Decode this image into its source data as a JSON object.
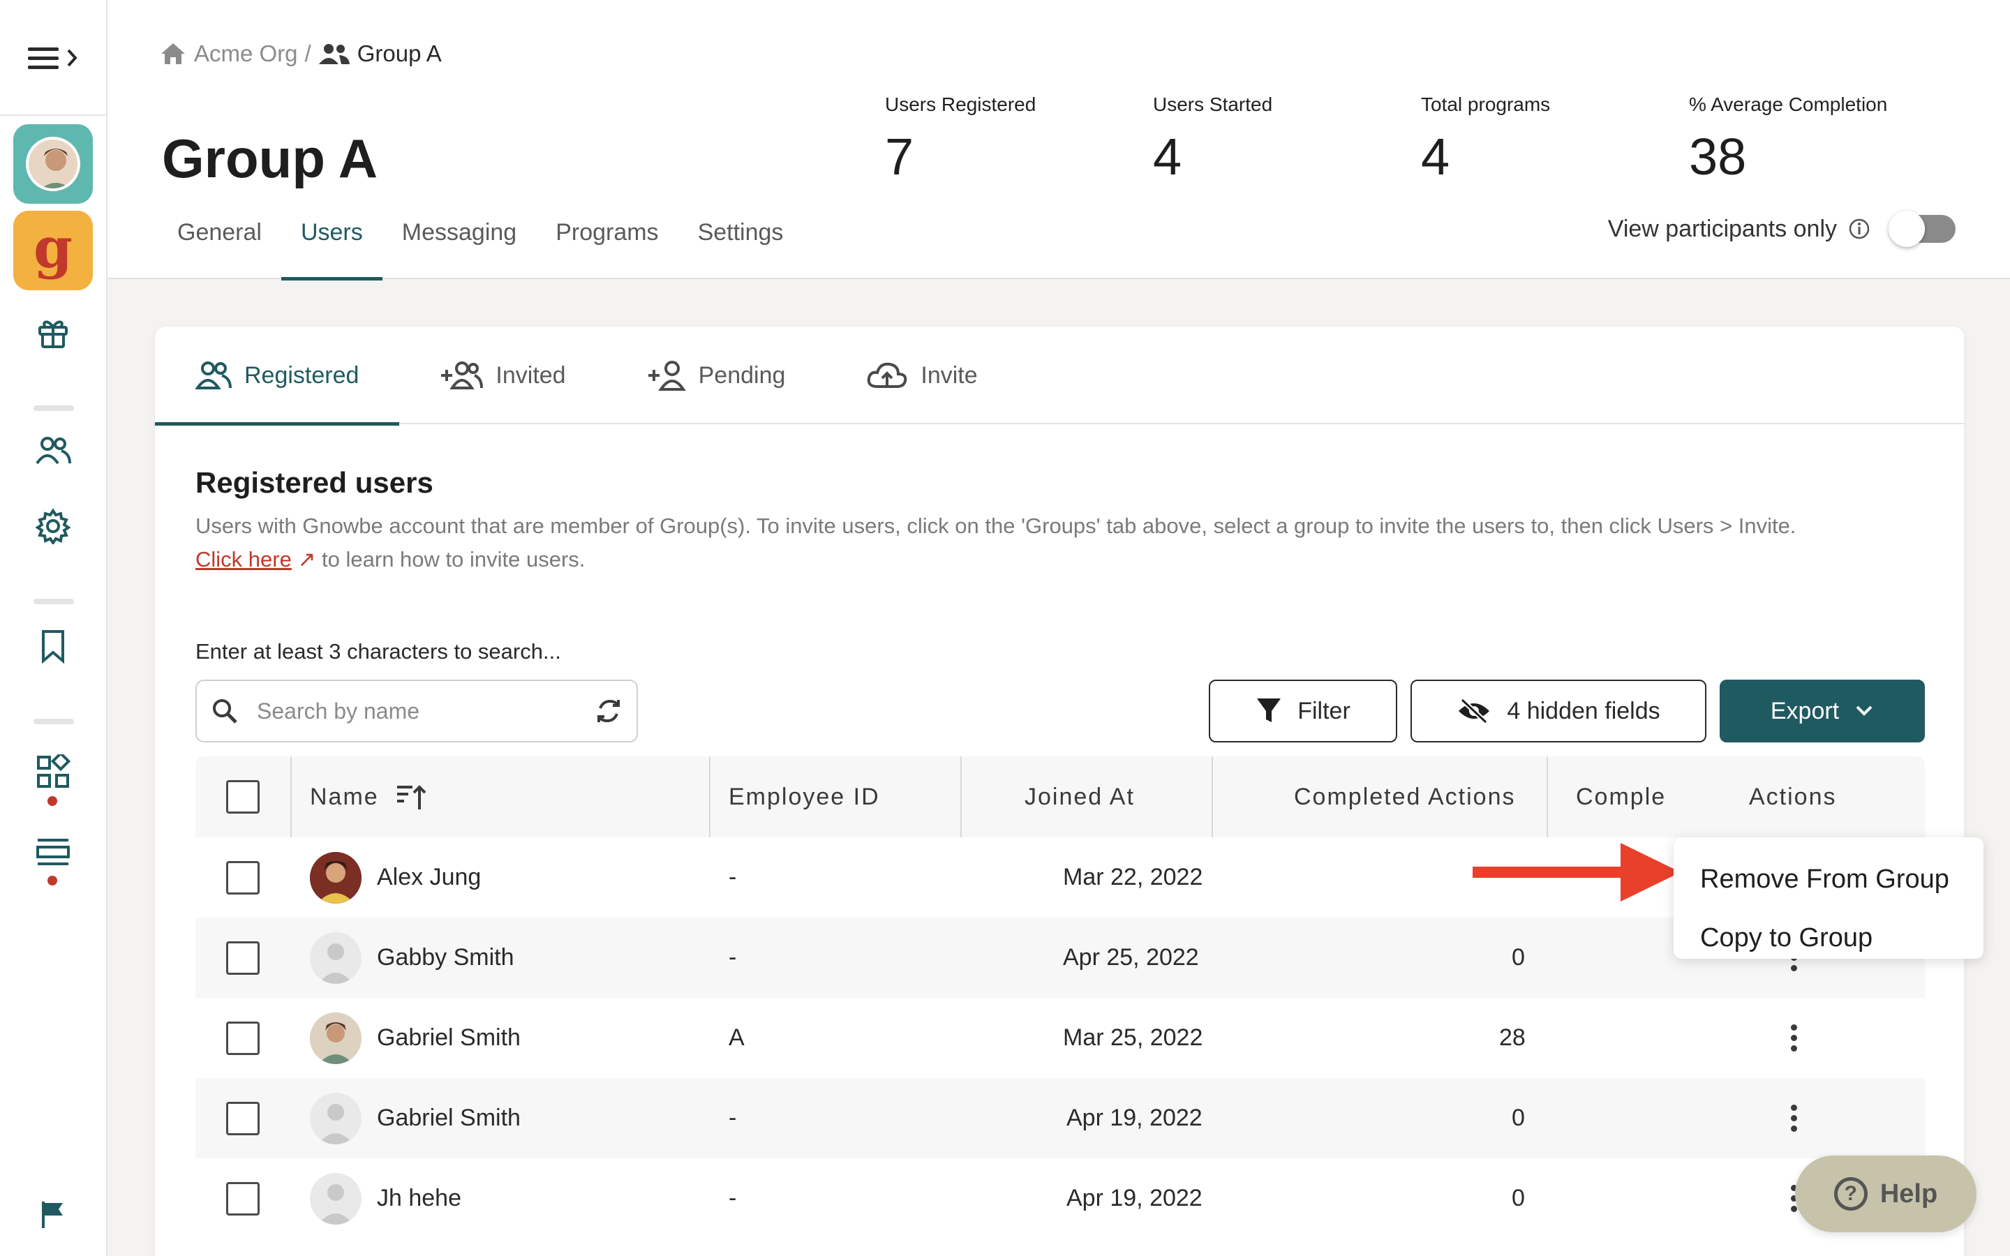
{
  "breadcrumb": {
    "org": "Acme Org",
    "separator": "/",
    "group": "Group A"
  },
  "page": {
    "title": "Group A"
  },
  "stats": [
    {
      "label": "Users Registered",
      "value": "7"
    },
    {
      "label": "Users Started",
      "value": "4"
    },
    {
      "label": "Total programs",
      "value": "4"
    },
    {
      "label": "% Average Completion",
      "value": "38"
    }
  ],
  "tabs": [
    "General",
    "Users",
    "Messaging",
    "Programs",
    "Settings"
  ],
  "active_tab": "Users",
  "participants_toggle": {
    "label": "View participants only",
    "on": false
  },
  "subtabs": [
    "Registered",
    "Invited",
    "Pending",
    "Invite"
  ],
  "section": {
    "title": "Registered users",
    "description": "Users with Gnowbe account that are member of Group(s). To invite users, click on the 'Groups' tab above, select a group to invite the users to, then click Users > Invite.",
    "link_text": "Click here",
    "link_suffix": " to learn how to invite users."
  },
  "search": {
    "hint": "Enter at least 3 characters to search...",
    "placeholder": "Search by name"
  },
  "toolbar": {
    "filter_label": "Filter",
    "hidden_fields_label": "4 hidden fields",
    "export_label": "Export"
  },
  "table": {
    "columns": [
      "Name",
      "Employee ID",
      "Joined At",
      "Completed Actions",
      "Comple",
      "Actions"
    ],
    "rows": [
      {
        "name": "Alex Jung",
        "employee_id": "-",
        "joined_at": "Mar 22, 2022",
        "completed_actions": ""
      },
      {
        "name": "Gabby Smith",
        "employee_id": "-",
        "joined_at": "Apr 25, 2022",
        "completed_actions": "0"
      },
      {
        "name": "Gabriel Smith",
        "employee_id": "A",
        "joined_at": "Mar 25, 2022",
        "completed_actions": "28"
      },
      {
        "name": "Gabriel Smith",
        "employee_id": "-",
        "joined_at": "Apr 19, 2022",
        "completed_actions": "0"
      },
      {
        "name": "Jh hehe",
        "employee_id": "-",
        "joined_at": "Apr 19, 2022",
        "completed_actions": "0"
      }
    ]
  },
  "actions_menu": [
    "Remove From Group",
    "Copy to Group"
  ],
  "help": {
    "label": "Help"
  },
  "colors": {
    "accent": "#1f5a60",
    "brand_red": "#c0392b",
    "annotation_arrow": "#e8402a"
  }
}
